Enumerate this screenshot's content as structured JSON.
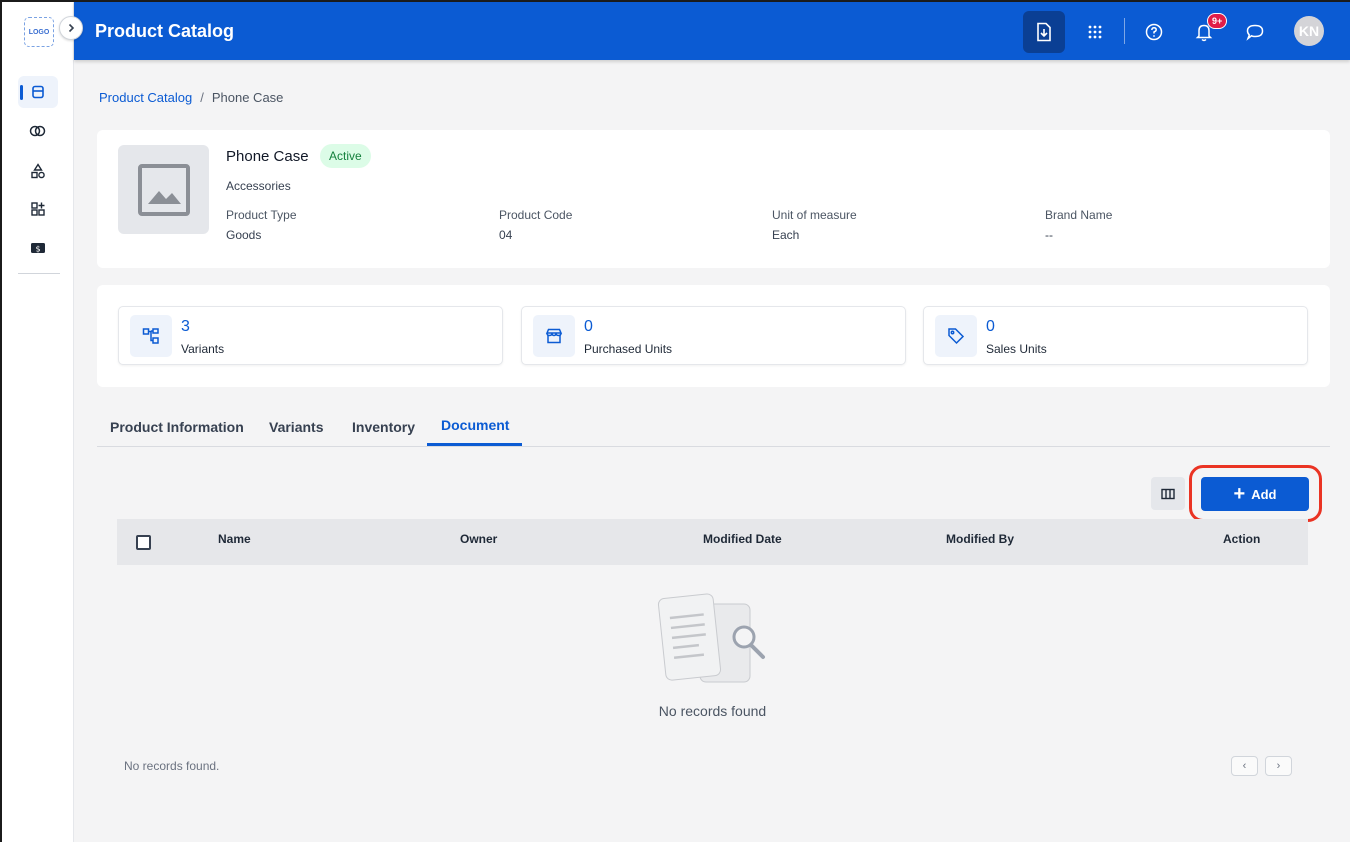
{
  "app": {
    "logo_text": "LOGO",
    "title": "Product Catalog",
    "avatar_initials": "KN",
    "notification_count": "9+"
  },
  "breadcrumb": {
    "root": "Product Catalog",
    "separator": "/",
    "current": "Phone Case"
  },
  "product": {
    "name": "Phone Case",
    "status": "Active",
    "category": "Accessories",
    "fields": [
      {
        "label": "Product Type",
        "value": "Goods"
      },
      {
        "label": "Product Code",
        "value": "04"
      },
      {
        "label": "Unit of measure",
        "value": "Each"
      },
      {
        "label": "Brand Name",
        "value": "--"
      }
    ]
  },
  "stats": [
    {
      "value": "3",
      "label": "Variants",
      "icon": "hierarchy-icon"
    },
    {
      "value": "0",
      "label": "Purchased Units",
      "icon": "store-icon"
    },
    {
      "value": "0",
      "label": "Sales Units",
      "icon": "tag-icon"
    }
  ],
  "tabs": [
    {
      "label": "Product Information"
    },
    {
      "label": "Variants"
    },
    {
      "label": "Inventory"
    },
    {
      "label": "Document",
      "active": true
    }
  ],
  "toolbar": {
    "add_label": "Add"
  },
  "table": {
    "columns": [
      "Name",
      "Owner",
      "Modified Date",
      "Modified By",
      "Action"
    ],
    "empty_text": "No records found",
    "footer_text": "No records found."
  },
  "colors": {
    "primary": "#0b5bd3",
    "active_badge_bg": "#dcfce7",
    "active_badge_text": "#15803d",
    "highlight": "#ea3323"
  }
}
